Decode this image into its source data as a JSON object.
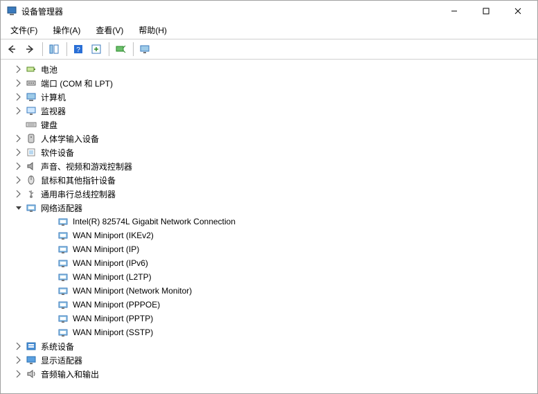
{
  "window": {
    "title": "设备管理器"
  },
  "menu": {
    "file": "文件(F)",
    "action": "操作(A)",
    "view": "查看(V)",
    "help": "帮助(H)"
  },
  "tree": {
    "items": [
      {
        "label": "电池",
        "icon": "battery",
        "expanded": false,
        "depth": 1
      },
      {
        "label": "端口 (COM 和 LPT)",
        "icon": "port",
        "expanded": false,
        "depth": 1
      },
      {
        "label": "计算机",
        "icon": "computer",
        "expanded": false,
        "depth": 1
      },
      {
        "label": "监视器",
        "icon": "monitor",
        "expanded": false,
        "depth": 1
      },
      {
        "label": "键盘",
        "icon": "keyboard",
        "expanded": false,
        "depth": 1,
        "leaf": true
      },
      {
        "label": "人体学输入设备",
        "icon": "hid",
        "expanded": false,
        "depth": 1
      },
      {
        "label": "软件设备",
        "icon": "software",
        "expanded": false,
        "depth": 1
      },
      {
        "label": "声音、视频和游戏控制器",
        "icon": "audio",
        "expanded": false,
        "depth": 1
      },
      {
        "label": "鼠标和其他指针设备",
        "icon": "mouse",
        "expanded": false,
        "depth": 1
      },
      {
        "label": "通用串行总线控制器",
        "icon": "usb",
        "expanded": false,
        "depth": 1
      },
      {
        "label": "网络适配器",
        "icon": "network",
        "expanded": true,
        "depth": 1,
        "children": [
          "Intel(R) 82574L Gigabit Network Connection",
          "WAN Miniport (IKEv2)",
          "WAN Miniport (IP)",
          "WAN Miniport (IPv6)",
          "WAN Miniport (L2TP)",
          "WAN Miniport (Network Monitor)",
          "WAN Miniport (PPPOE)",
          "WAN Miniport (PPTP)",
          "WAN Miniport (SSTP)"
        ]
      },
      {
        "label": "系统设备",
        "icon": "system",
        "expanded": false,
        "depth": 1
      },
      {
        "label": "显示适配器",
        "icon": "display",
        "expanded": false,
        "depth": 1
      },
      {
        "label": "音频输入和输出",
        "icon": "audioio",
        "expanded": false,
        "depth": 1
      }
    ]
  }
}
